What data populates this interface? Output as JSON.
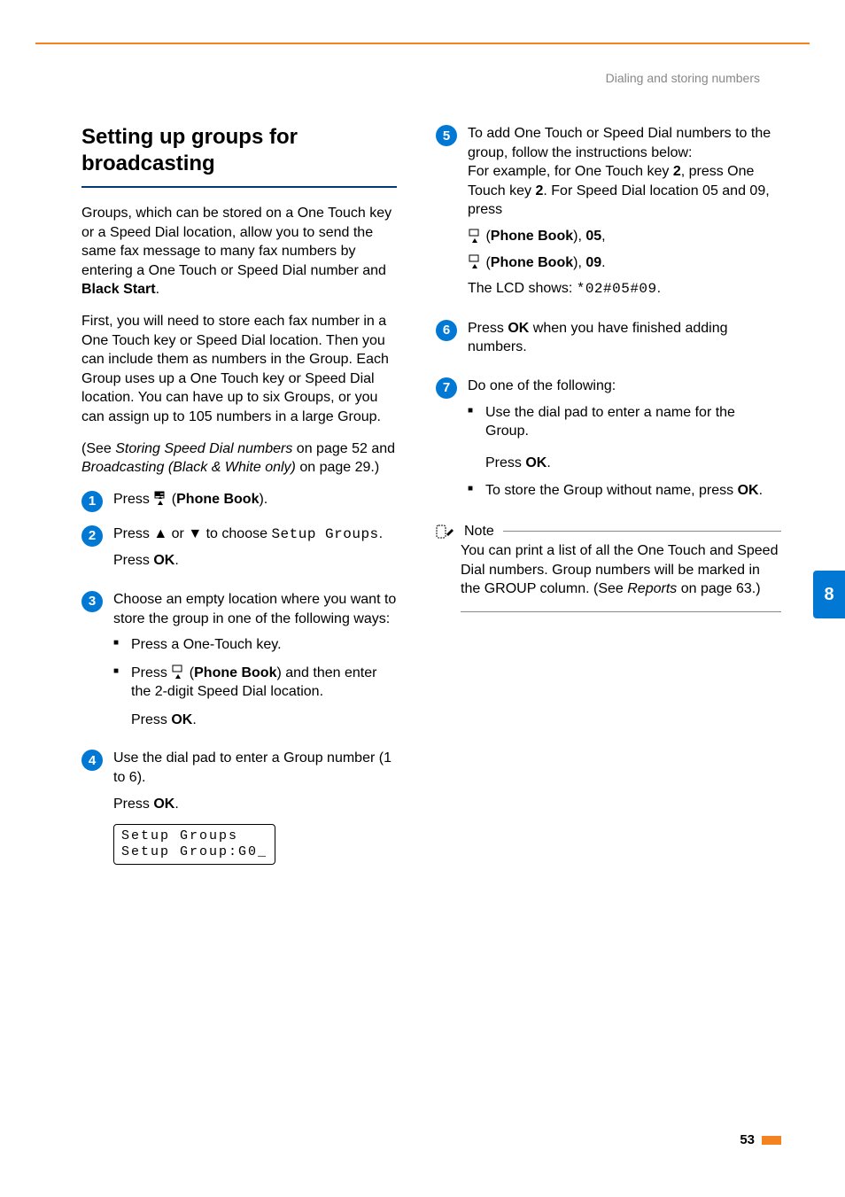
{
  "headerRight": "Dialing and storing numbers",
  "sectionTitle": "Setting up groups for broadcasting",
  "para1_a": "Groups, which can be stored on a One Touch key or a Speed Dial location, allow you to send the same fax message to many fax numbers by entering a One Touch or Speed Dial number and ",
  "para1_b": "Black Start",
  "para1_c": ".",
  "para2": "First, you will need to store each fax number in a One Touch key or Speed Dial location. Then you can include them as numbers in the Group. Each Group uses up a One Touch key or Speed Dial location. You can have up to six Groups, or you can assign up to 105 numbers in a large Group.",
  "seeStoring_a": "(See ",
  "seeStoring_b": "Storing Speed Dial numbers",
  "seeStoring_c": " on page 52 and ",
  "seeStoring_d": "Broadcasting (Black & White only)",
  "seeStoring_e": " on page 29.)",
  "step1_a": "Press ",
  "step1_pb": "Phone Book",
  "step1_b": ").",
  "step2_a": "Press ",
  "step2_b": " or ",
  "step2_c": " to choose ",
  "step2_d": "Setup Groups",
  "step2_e": ".",
  "pressOK": "Press ",
  "okWord": "OK",
  "period": ".",
  "step3_intro": "Choose an empty location where you want to store the group in one of the following ways:",
  "step3_li1": "Press a One-Touch key.",
  "step3_li2_a": "Press ",
  "step3_li2_b": "Phone Book",
  "step3_li2_c": ") and then enter the 2-digit Speed Dial location.",
  "step4_a": "Use the dial pad to enter a Group number (1 to 6).",
  "lcd_line1": "Setup Groups",
  "lcd_line2": "Setup Group:G0_",
  "step5_a": "To add One Touch or Speed Dial numbers to the group, follow the instructions below:",
  "step5_b": "For example, for One Touch key ",
  "step5_key2a": "2",
  "step5_c": ", press One Touch key ",
  "step5_key2b": "2",
  "step5_d": ". For Speed Dial location 05 and 09, press",
  "step5_pb1_a": "Phone Book",
  "step5_pb1_b": "05",
  "step5_pb2_a": "Phone Book",
  "step5_pb2_b": "09",
  "step5_lcd_a": "The LCD shows: ",
  "step5_lcd_b": "*02#05#09",
  "step6_a": "Press ",
  "step6_b": " when you have finished adding numbers.",
  "step7_intro": "Do one of the following:",
  "step7_li1": "Use the dial pad to enter a name for the Group.",
  "step7_li2_a": "To store the Group without name, press ",
  "noteLabel": "Note",
  "noteBody_a": "You can print a list of all the One Touch and Speed Dial numbers. Group numbers will be marked in the GROUP column. (See ",
  "noteBody_b": "Reports",
  "noteBody_c": " on page 63.)",
  "sideTab": "8",
  "pageNum": "53",
  "arrowUp": "▲",
  "arrowDown": "▼"
}
